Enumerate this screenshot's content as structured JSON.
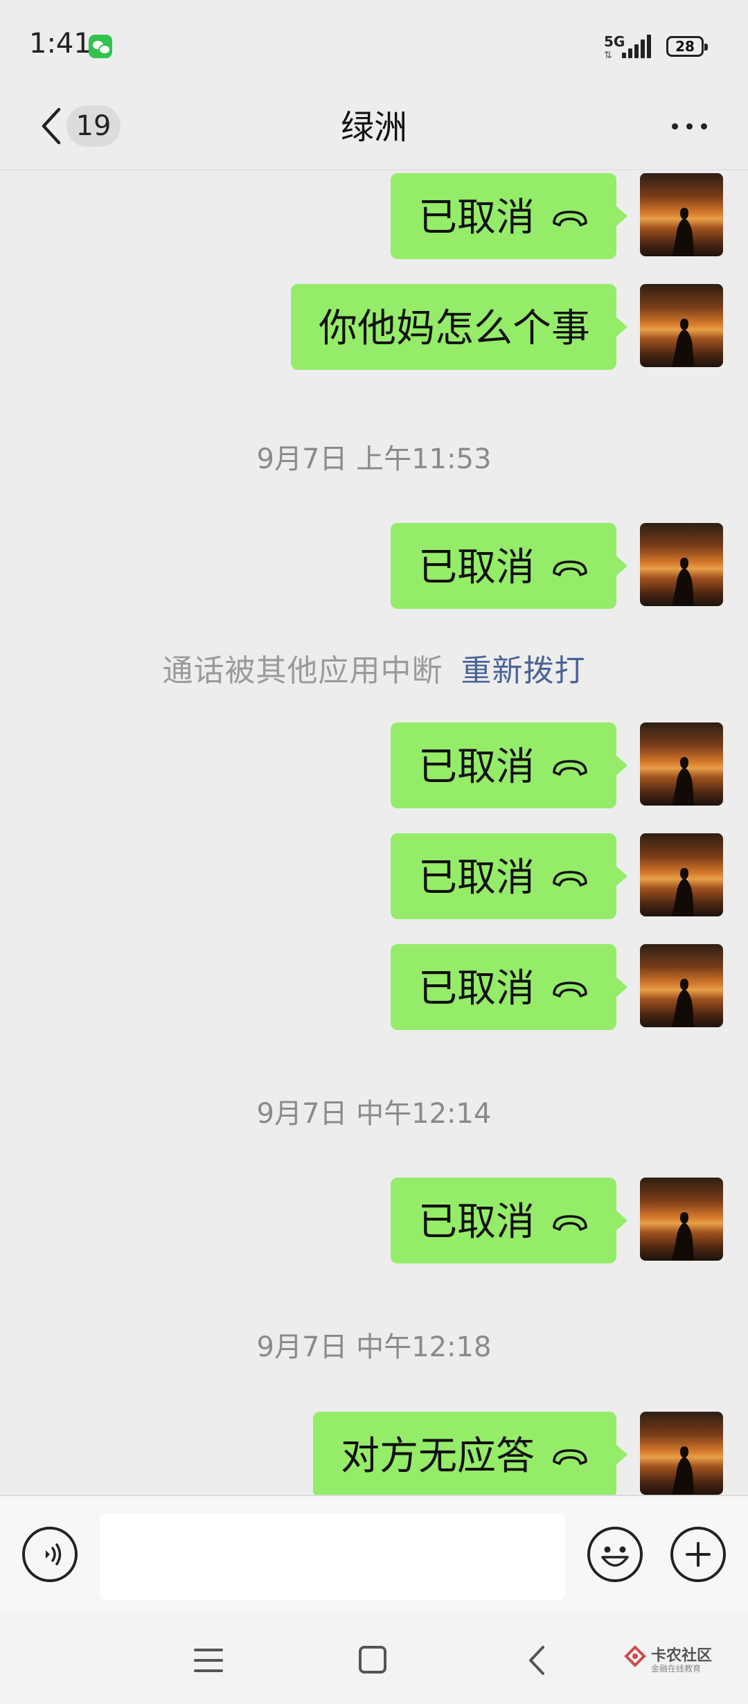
{
  "status_bar": {
    "time": "1:41",
    "network": "5G",
    "battery": "28"
  },
  "nav": {
    "unread_count": "19",
    "title": "绿洲"
  },
  "colors": {
    "bubble": "#95ec69",
    "background": "#ededed",
    "link": "#4a6396"
  },
  "messages": [
    {
      "text": "已取消",
      "call_icon": true
    },
    {
      "text": "你他妈怎么个事",
      "call_icon": false
    },
    {
      "timestamp": "9月7日 上午11:53"
    },
    {
      "text": "已取消",
      "call_icon": true
    },
    {
      "system": "通话被其他应用中断",
      "link": "重新拨打"
    },
    {
      "text": "已取消",
      "call_icon": true
    },
    {
      "text": "已取消",
      "call_icon": true
    },
    {
      "text": "已取消",
      "call_icon": true
    },
    {
      "timestamp": "9月7日 中午12:14"
    },
    {
      "text": "已取消",
      "call_icon": true
    },
    {
      "timestamp": "9月7日 中午12:18"
    },
    {
      "text": "对方无应答",
      "call_icon": true
    }
  ],
  "input": {
    "value": "",
    "placeholder": ""
  },
  "icons": {
    "back": "chevron-left-icon",
    "more": "more-dots-icon",
    "voice": "voice-icon",
    "emoji": "emoji-icon",
    "plus": "plus-icon",
    "call": "hang-up-icon"
  },
  "watermark": {
    "title": "卡农社区",
    "subtitle": "金融在线教育"
  }
}
